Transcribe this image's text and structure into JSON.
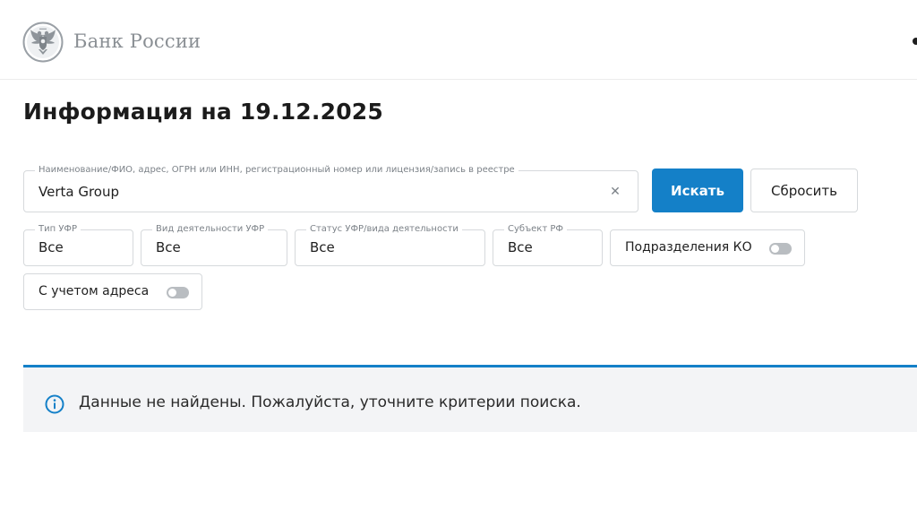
{
  "header": {
    "logo_text": "Банк России",
    "logo_icon": "eagle-emblem-icon"
  },
  "page": {
    "title": "Информация на 19.12.2025"
  },
  "search": {
    "legend": "Наименование/ФИО, адрес, ОГРН или ИНН, регистрационный номер или лицензия/запись в реестре",
    "value": "Verta Group",
    "clear_icon": "close-icon",
    "search_label": "Искать",
    "reset_label": "Сбросить"
  },
  "filters": {
    "type": {
      "legend": "Тип УФР",
      "value": "Все"
    },
    "activity": {
      "legend": "Вид деятельности УФР",
      "value": "Все"
    },
    "status": {
      "legend": "Статус УФР/вида деятельности",
      "value": "Все"
    },
    "subject": {
      "legend": "Субъект РФ",
      "value": "Все"
    },
    "divisions_toggle": {
      "label": "Подразделения КО",
      "on": false
    },
    "address_toggle": {
      "label": "С учетом адреса",
      "on": false
    }
  },
  "result": {
    "icon": "info-icon",
    "message": "Данные не найдены. Пожалуйста, уточните критерии поиска."
  },
  "colors": {
    "accent": "#1480c8",
    "notice_bg": "#f3f4f6",
    "border": "#d6d9dc",
    "muted_text": "#7c8288"
  }
}
